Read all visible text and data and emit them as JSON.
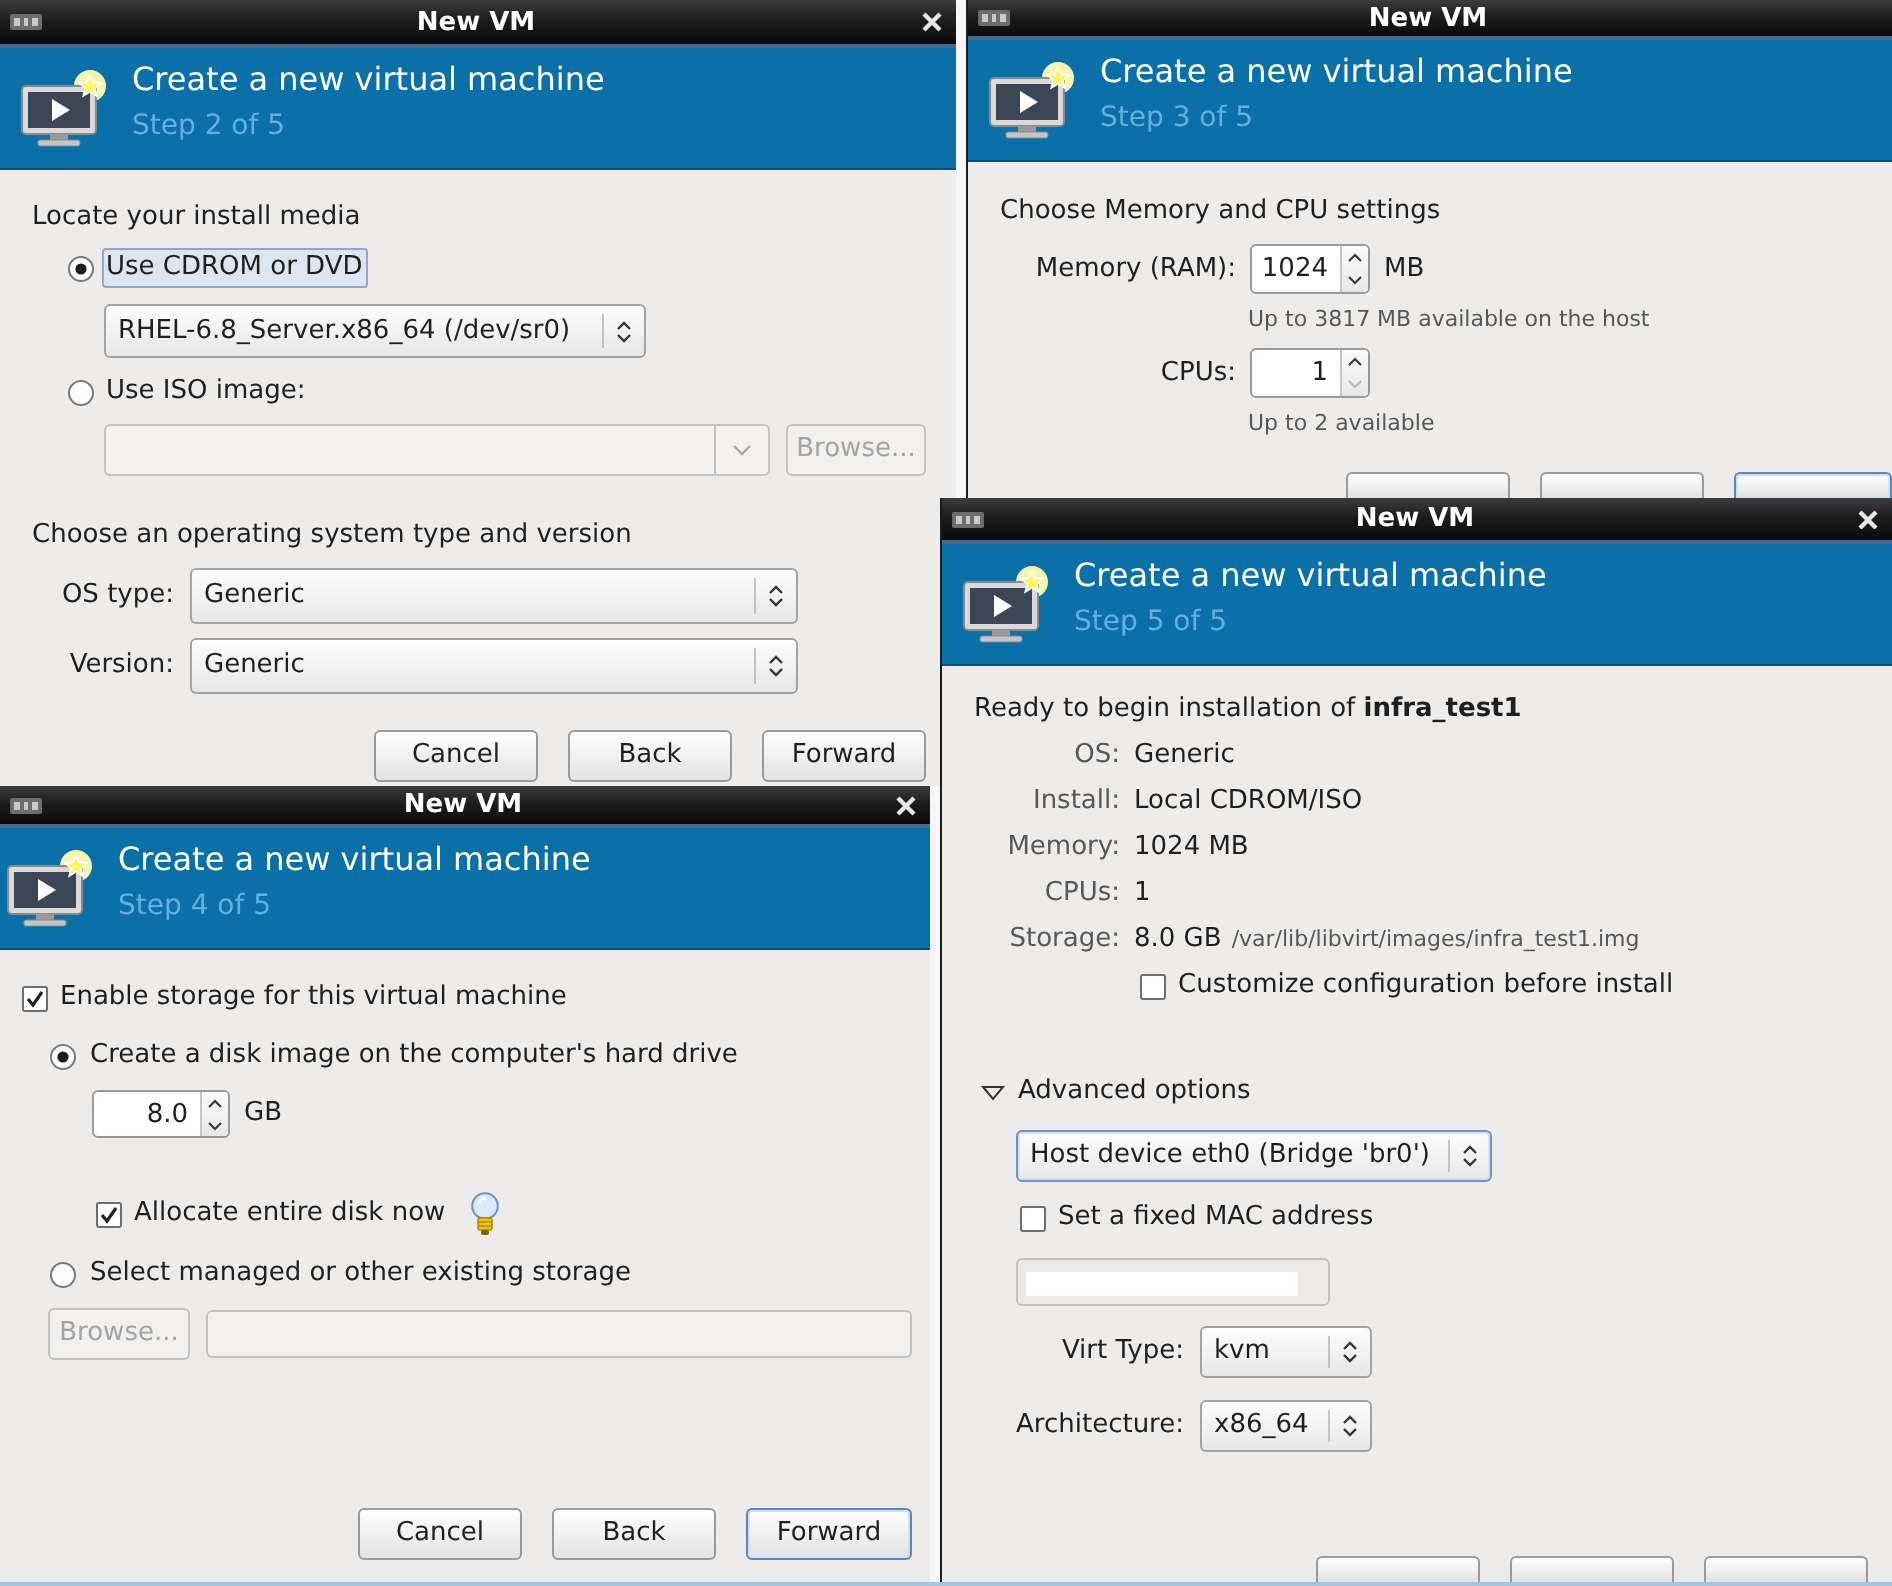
{
  "windows": [
    {
      "kind": "media",
      "title": "New VM",
      "heading": "Create a new virtual machine",
      "step": "Step 2 of 5",
      "section_1": "Locate your install media",
      "sources": [
        {
          "kind": "select",
          "label": "Use CDROM or DVD",
          "selected": true,
          "focused": true,
          "value": "RHEL-6.8_Server.x86_64 (/dev/sr0)"
        },
        {
          "kind": "path",
          "label": "Use ISO image:",
          "selected": false,
          "focused": false,
          "disabled": true,
          "browse": {
            "label": "Browse...",
            "disabled": true
          }
        }
      ],
      "section_2": "Choose an operating system type and version",
      "fields": [
        {
          "label": "OS type:",
          "value": "Generic"
        },
        {
          "label": "Version:",
          "value": "Generic"
        }
      ],
      "buttons": [
        {
          "label": "Cancel",
          "focused": false
        },
        {
          "label": "Back",
          "focused": false
        },
        {
          "label": "Forward",
          "focused": false
        }
      ]
    },
    {
      "kind": "storage",
      "title": "New VM",
      "heading": "Create a new virtual machine",
      "step": "Step 4 of 5",
      "enable": {
        "label": "Enable storage for this virtual machine",
        "checked": true
      },
      "options": [
        {
          "kind": "disk",
          "label": "Create a disk image on the computer's hard drive",
          "selected": true,
          "size": {
            "value": "8.0",
            "unit": "GB"
          },
          "allocate": {
            "label": "Allocate entire disk now",
            "checked": true
          }
        },
        {
          "kind": "existing",
          "label": "Select managed or other existing storage",
          "selected": false,
          "browse": {
            "label": "Browse...",
            "disabled": true
          },
          "path": {
            "disabled": true
          }
        }
      ],
      "buttons": [
        {
          "label": "Cancel",
          "focused": false
        },
        {
          "label": "Back",
          "focused": false
        },
        {
          "label": "Forward",
          "focused": true
        }
      ]
    },
    {
      "kind": "memory",
      "title": "New VM",
      "heading": "Create a new virtual machine",
      "step": "Step 3 of 5",
      "section": "Choose Memory and CPU settings",
      "spinners": [
        {
          "label": "Memory (RAM):",
          "value": "1024",
          "unit": "MB",
          "hint": "Up to 3817 MB available on the host",
          "down_disabled": false
        },
        {
          "label": "CPUs:",
          "value": "1",
          "hint": "Up to 2 available",
          "down_disabled": true
        }
      ],
      "buttons": [
        {
          "focused": false
        },
        {
          "focused": false
        },
        {
          "focused": true
        }
      ]
    },
    {
      "kind": "summary",
      "title": "New VM",
      "heading": "Create a new virtual machine",
      "step": "Step 5 of 5",
      "intro": "Ready to begin installation of **infra_test1**",
      "details": [
        {
          "label": "OS:",
          "value": "Generic"
        },
        {
          "label": "Install:",
          "value": "Local CDROM/ISO"
        },
        {
          "label": "Memory:",
          "value": "1024 MB"
        },
        {
          "label": "CPUs:",
          "value": "1"
        },
        {
          "label": "Storage:",
          "value": "8.0 GB",
          "note": "/var/lib/libvirt/images/infra_test1.img"
        }
      ],
      "customize": {
        "label": "Customize configuration before install",
        "checked": false
      },
      "advanced": {
        "label": "Advanced options",
        "expanded": true,
        "network": {
          "value": "Host device eth0 (Bridge 'br0')",
          "focused": true
        },
        "mac": {
          "label": "Set a fixed MAC address",
          "checked": false
        },
        "mac_field": {
          "disabled": true
        },
        "fields": [
          {
            "label": "Virt Type:",
            "value": "kvm"
          },
          {
            "label": "Architecture:",
            "value": "x86_64"
          }
        ]
      },
      "buttons": [
        {
          "focused": false
        },
        {
          "focused": false
        },
        {
          "focused": false
        }
      ]
    }
  ]
}
